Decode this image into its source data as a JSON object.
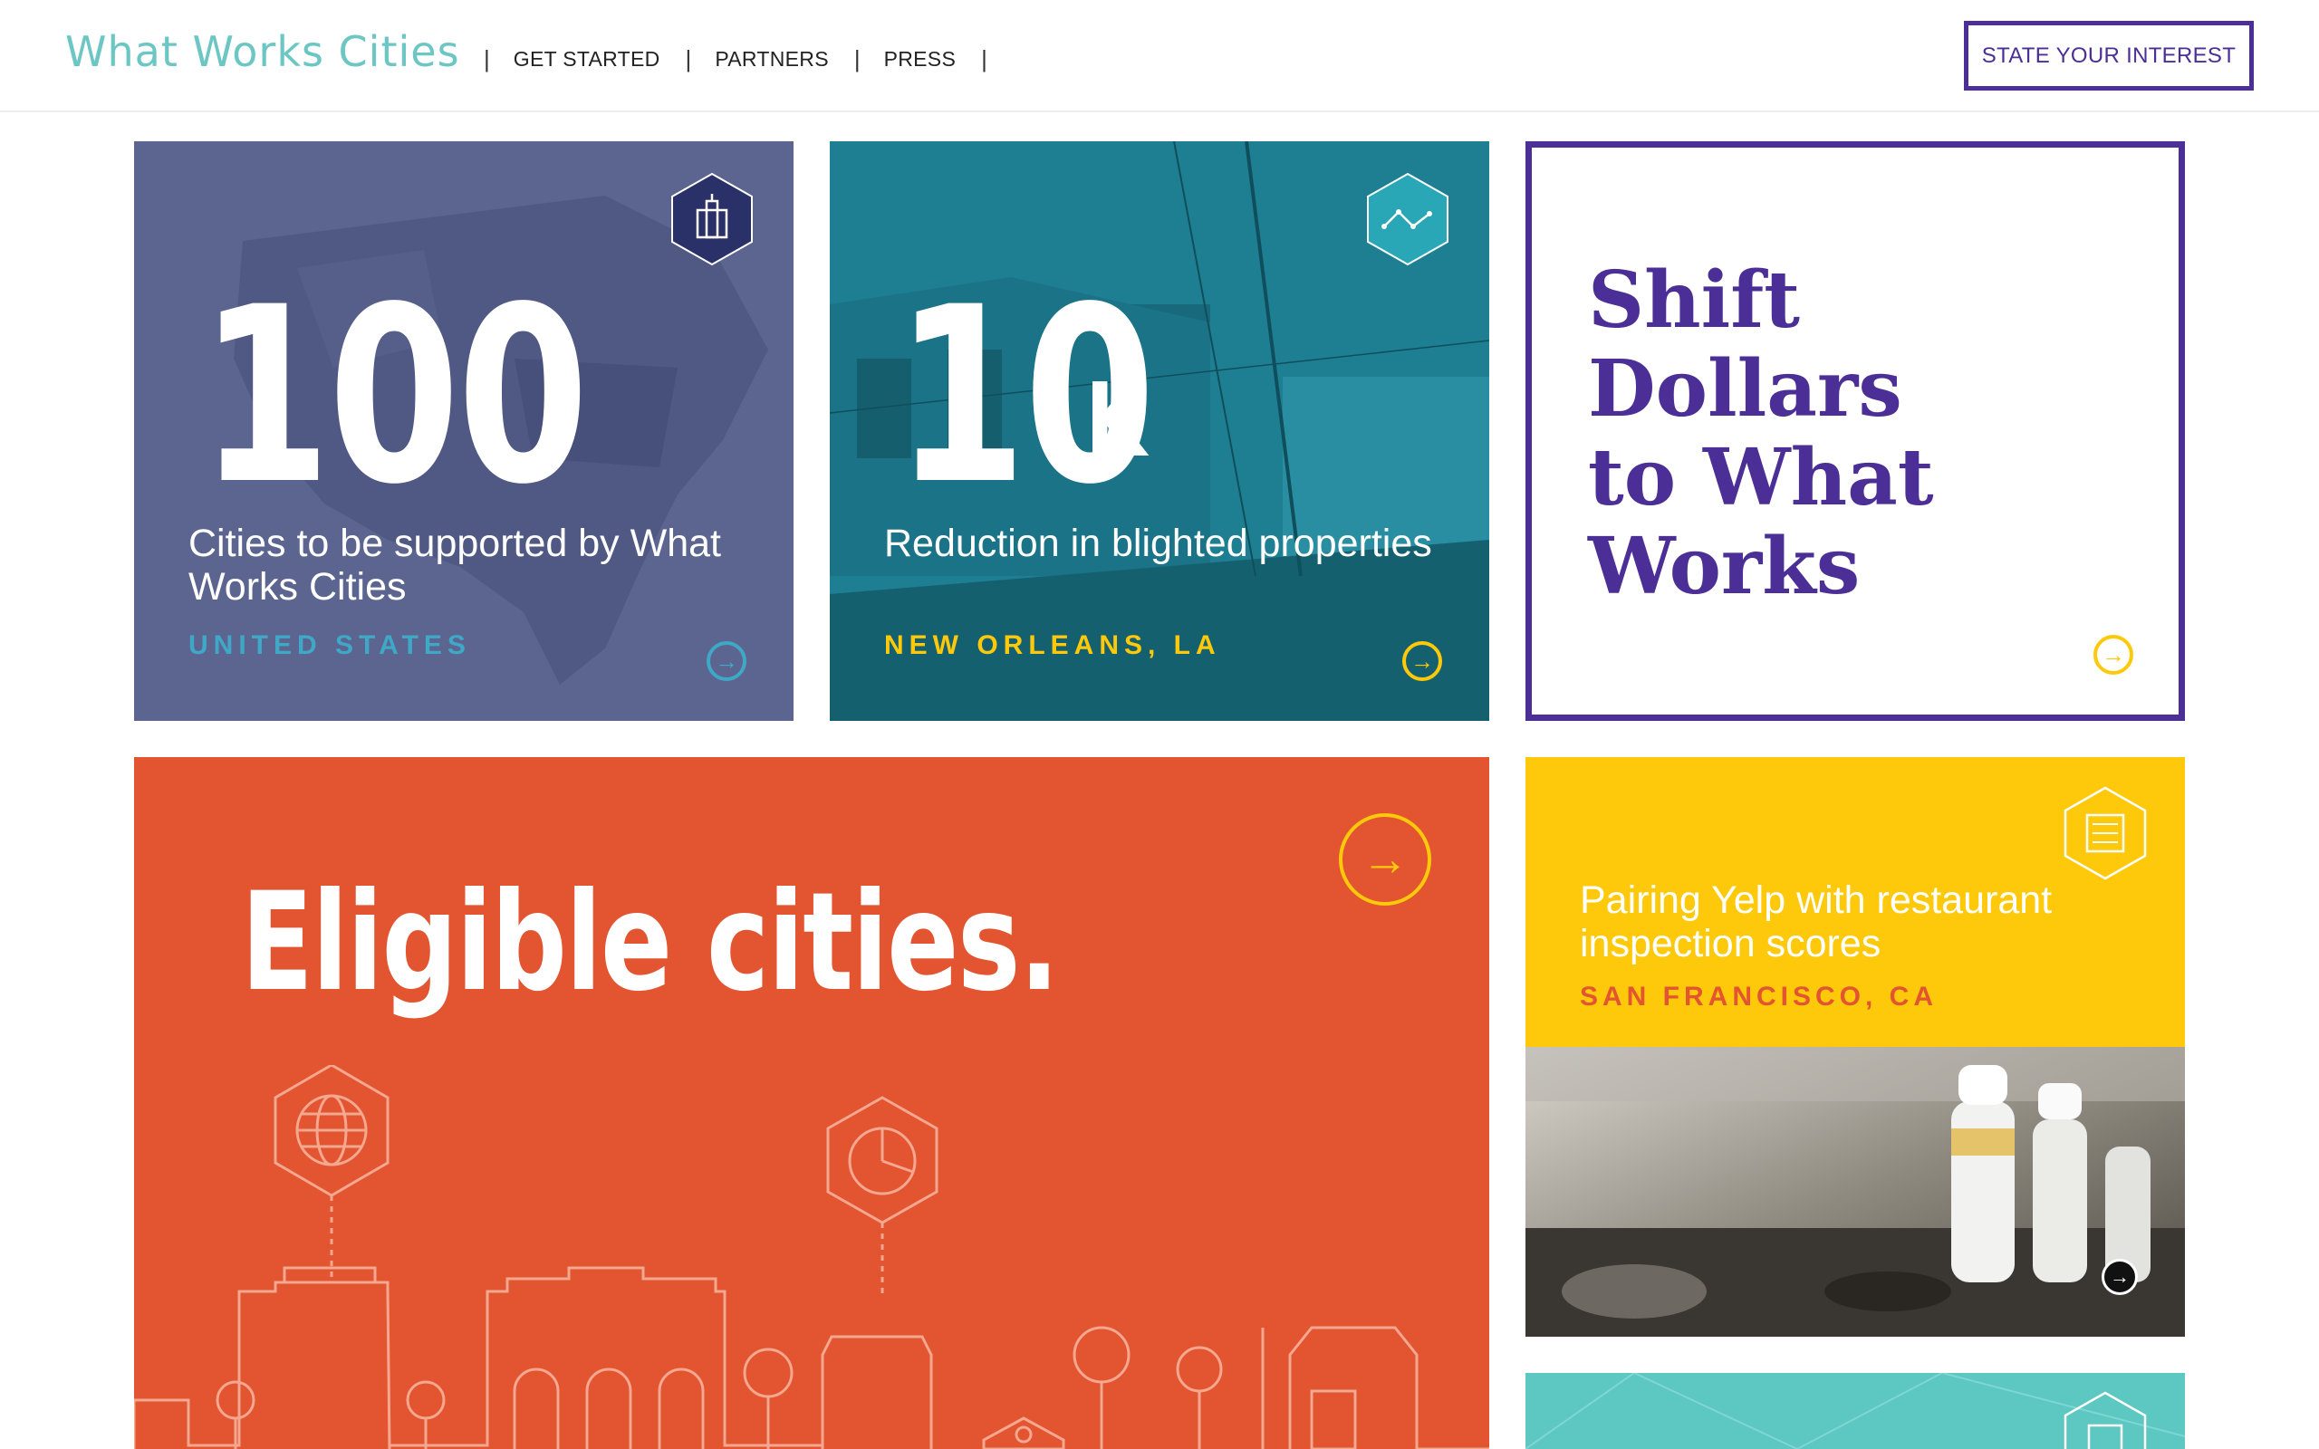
{
  "header": {
    "logo": "What Works Cities",
    "nav": [
      {
        "label": "GET STARTED"
      },
      {
        "label": "PARTNERS"
      },
      {
        "label": "PRESS"
      }
    ],
    "cta": "STATE YOUR INTEREST"
  },
  "tiles": {
    "cities": {
      "number": "100",
      "description": "Cities to be supported by What Works Cities",
      "location": "UNITED STATES",
      "icon": "building-hex-icon"
    },
    "blight": {
      "number": "10",
      "suffix": "K",
      "description": "Reduction in blighted properties",
      "location": "NEW ORLEANS, LA",
      "icon": "line-chart-hex-icon"
    },
    "shift": {
      "lines": [
        "Shift",
        "Dollars",
        "to What Works"
      ]
    },
    "eligible": {
      "headline": "Eligible cities."
    },
    "yelp": {
      "description": "Pairing Yelp with restaurant inspection scores",
      "location": "SAN FRANCISCO, CA",
      "icon": "document-hex-icon"
    }
  },
  "colors": {
    "brand_purple": "#4b2e96",
    "teal_logo": "#6cc6c3",
    "slate_tile": "#5c6490",
    "teal_tile": "#1e7e92",
    "orange_tile": "#e25530",
    "yellow_tile": "#fdc90a",
    "aqua_tile": "#5dc7c2"
  }
}
